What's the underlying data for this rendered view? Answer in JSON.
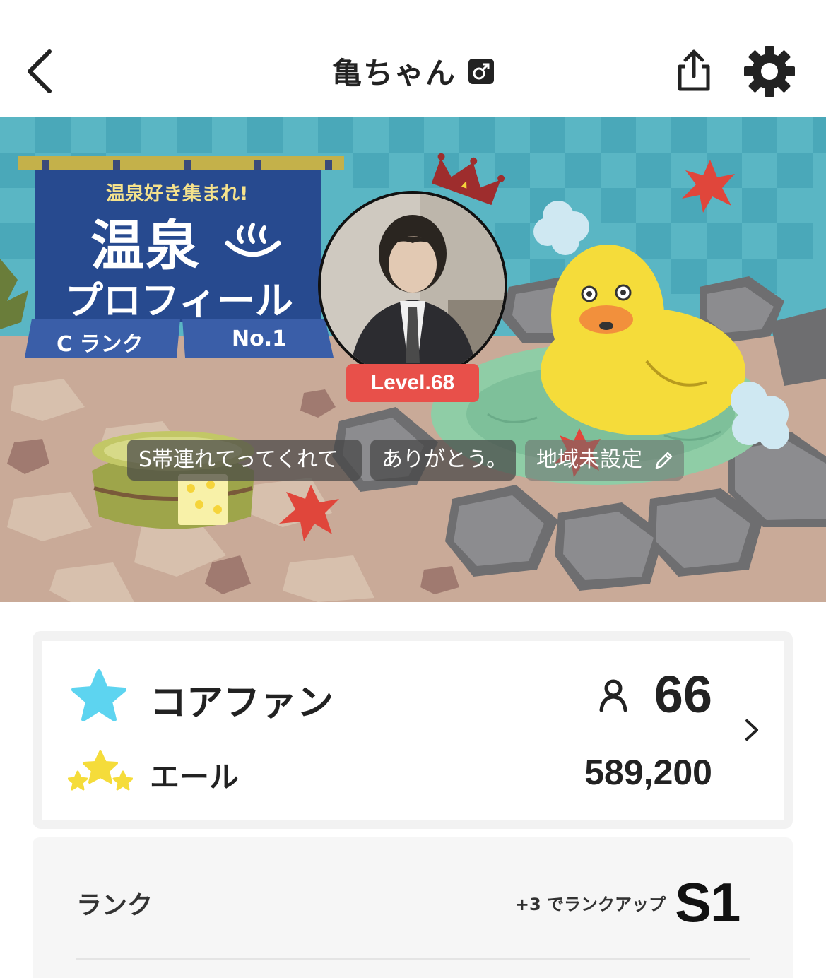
{
  "header": {
    "title": "亀ちゃん"
  },
  "banner": {
    "curtain_tagline": "温泉好き集まれ!",
    "curtain_title_1": "温泉",
    "curtain_title_2": "プロフィール",
    "curtain_rank": "C ランク",
    "curtain_number": "No.1",
    "level": "Level.68",
    "tags": [
      "S帯連れてってくれて",
      "ありがとう。"
    ],
    "region": "地域未設定"
  },
  "fans": {
    "core_label": "コアファン",
    "core_count": "66",
    "yell_label": "エール",
    "yell_count": "589,200"
  },
  "rank": {
    "label": "ランク",
    "up_text": "+3 でランクアップ",
    "value": "S1"
  },
  "colors": {
    "level_badge": "#e8504a",
    "star_core": "#5dd4f0",
    "star_yell": "#f5dc3a"
  }
}
